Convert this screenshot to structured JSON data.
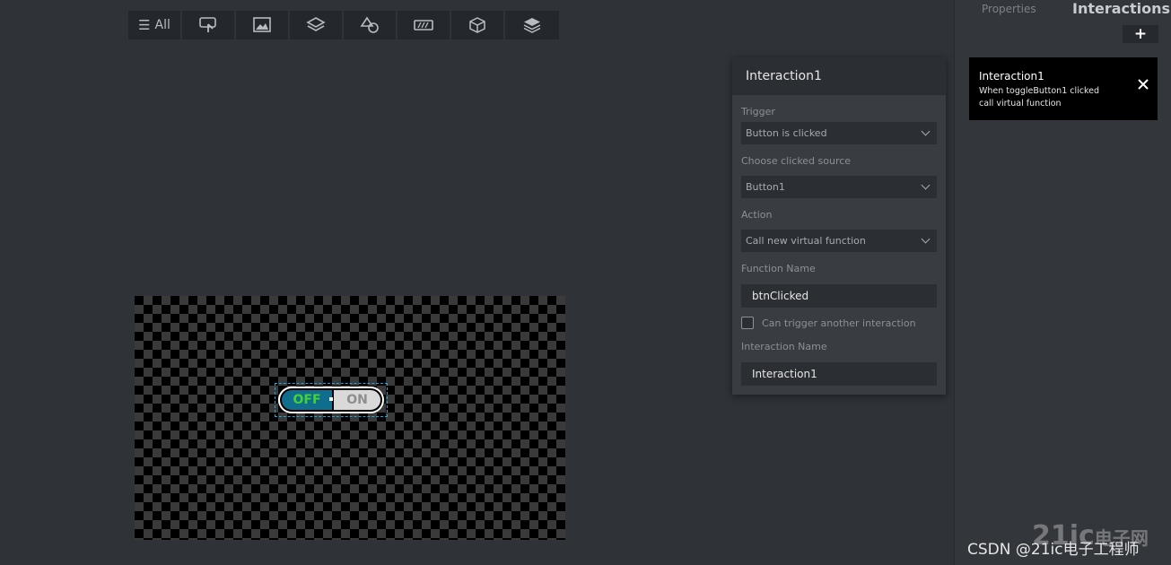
{
  "toolbar": {
    "all_label": "All",
    "icons": [
      "interaction-icon",
      "image-icon",
      "layers-icon",
      "shapes-icon",
      "progress-icon",
      "cube-icon",
      "stack-icon"
    ]
  },
  "canvas": {
    "toggle": {
      "off_label": "OFF",
      "on_label": "ON"
    }
  },
  "popup": {
    "title": "Interaction1",
    "trigger_label": "Trigger",
    "trigger_value": "Button is clicked",
    "source_label": "Choose clicked source",
    "source_value": "Button1",
    "action_label": "Action",
    "action_value": "Call new virtual function",
    "function_name_label": "Function Name",
    "function_name_value": "btnClicked",
    "checkbox_label": "Can trigger another interaction",
    "interaction_name_label": "Interaction Name",
    "interaction_name_value": "Interaction1"
  },
  "sidepanel": {
    "tab_properties": "Properties",
    "tab_interactions": "Interactions",
    "add_label": "+",
    "card": {
      "title": "Interaction1",
      "line1": "When toggleButton1 clicked",
      "line2": "call virtual function"
    }
  },
  "watermark": {
    "text": "CSDN @21ic电子工程师",
    "logo": "21ic",
    "logo_sub": "电子网"
  },
  "colors": {
    "background": "#2f3237",
    "panel": "#393c41",
    "toggle_off": "#0f6e8e",
    "toggle_off_text": "#43d335",
    "selection": "#22a6d6"
  }
}
